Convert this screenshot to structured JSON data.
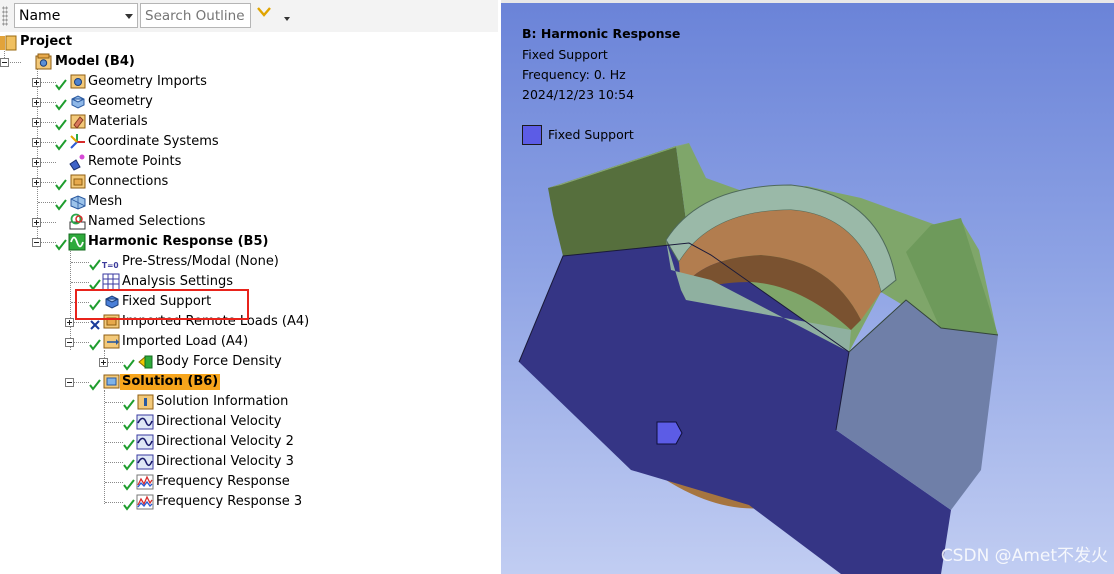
{
  "toolbar": {
    "name_select_value": "Name",
    "search_placeholder": "Search Outline"
  },
  "tree": {
    "project": "Project",
    "model": "Model (B4)",
    "geometry_imports": "Geometry Imports",
    "geometry": "Geometry",
    "materials": "Materials",
    "coordinate_systems": "Coordinate Systems",
    "remote_points": "Remote Points",
    "connections": "Connections",
    "mesh": "Mesh",
    "named_selections": "Named Selections",
    "harmonic_response": "Harmonic Response (B5)",
    "pre_stress": "Pre-Stress/Modal (None)",
    "analysis_settings": "Analysis Settings",
    "fixed_support": "Fixed Support",
    "imported_remote_loads": "Imported Remote Loads (A4)",
    "imported_load": "Imported Load (A4)",
    "body_force_density": "Body Force Density",
    "solution": "Solution (B6)",
    "solution_information": "Solution Information",
    "directional_velocity": "Directional Velocity",
    "directional_velocity_2": "Directional Velocity 2",
    "directional_velocity_3": "Directional Velocity 3",
    "frequency_response": "Frequency Response",
    "frequency_response_3": "Frequency Response 3",
    "prestress_badge": "T=0"
  },
  "viewport": {
    "title": "B: Harmonic Response",
    "subtitle": "Fixed Support",
    "frequency": "Frequency: 0. Hz",
    "timestamp": "2024/12/23 10:54",
    "legend_label": "Fixed Support",
    "watermark": "CSDN @Amet不发火",
    "colors": {
      "fixed_support": "#5c5ce6",
      "selected_face": "#353585",
      "body_green": "#6f9a62",
      "inner_copper": "#b27d4f",
      "highlight": "#f7a51c",
      "annotation_red": "#e8231b"
    }
  }
}
